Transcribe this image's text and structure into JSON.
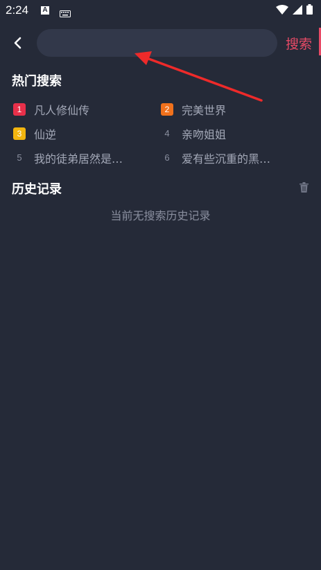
{
  "status_bar": {
    "time": "2:24",
    "a_icon": "A",
    "icons": [
      "keyboard-icon",
      "wifi-icon",
      "signal-icon",
      "battery-icon"
    ]
  },
  "top_bar": {
    "back_icon": "chevron-left-icon",
    "search_placeholder": "",
    "search_value": "",
    "search_button_label": "搜索"
  },
  "hot_search": {
    "title": "热门搜索",
    "items": [
      {
        "rank": "1",
        "label": "凡人修仙传",
        "badge_color": "#e8304a"
      },
      {
        "rank": "2",
        "label": "完美世界",
        "badge_color": "#f0711c"
      },
      {
        "rank": "3",
        "label": "仙逆",
        "badge_color": "#f2b50f"
      },
      {
        "rank": "4",
        "label": "亲吻姐姐",
        "badge_color": ""
      },
      {
        "rank": "5",
        "label": "我的徒弟居然是…",
        "badge_color": ""
      },
      {
        "rank": "6",
        "label": "爱有些沉重的黑…",
        "badge_color": ""
      }
    ]
  },
  "history": {
    "title": "历史记录",
    "trash_icon": "trash-icon",
    "empty_text": "当前无搜索历史记录"
  },
  "colors": {
    "background": "#252a38",
    "input_bg": "#32384a",
    "accent": "#e84a66",
    "annotation_arrow": "#ee2a2a"
  }
}
